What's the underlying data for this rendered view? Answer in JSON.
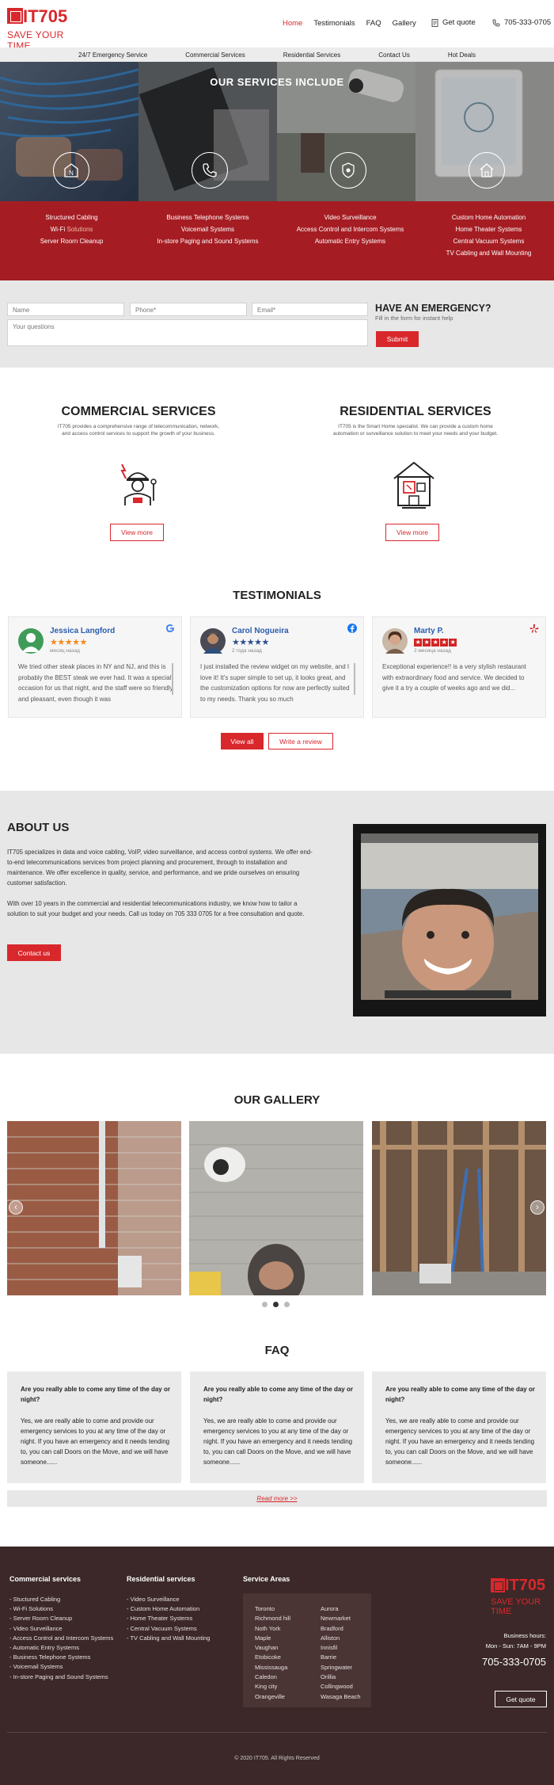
{
  "brand": {
    "name": "IT705",
    "tagline": "SAVE YOUR TIME"
  },
  "nav": {
    "items": [
      "Home",
      "Testimonials",
      "FAQ",
      "Gallery"
    ],
    "active": "Home",
    "quote": "Get quote",
    "phone": "705-333-0705"
  },
  "subnav": [
    "24/7 Emergency Service",
    "Commercial Services",
    "Residential Services",
    "Contact Us",
    "Hot Deals"
  ],
  "services": {
    "title": "OUR SERVICES INCLUDE",
    "columns": [
      {
        "icon": "network-icon",
        "items": [
          "Structured Cabling",
          "Wi-Fi Solutions",
          "Server Roorn Cleanup"
        ],
        "highlight": "Solutions"
      },
      {
        "icon": "phone-icon",
        "items": [
          "Business Telephone Systems",
          "Voicemail Systems",
          "In-store Paging and Sound Systems"
        ]
      },
      {
        "icon": "shield-icon",
        "items": [
          "Video Surveillance",
          "Access Control and Intercom Systems",
          "Automatic Entry Systems"
        ]
      },
      {
        "icon": "home-icon",
        "items": [
          "Custom Home Automation",
          "Home Theater Systems",
          "Central Vacuum Systems",
          "TV Cabling and Wall Mounting"
        ]
      }
    ]
  },
  "form": {
    "name_ph": "Name",
    "phone_ph": "Phone*",
    "email_ph": "Email*",
    "questions_ph": "Your questions",
    "title": "HAVE AN EMERGENCY?",
    "subtitle": "Fill in the form for instant help",
    "submit": "Submit"
  },
  "commercial": {
    "title": "COMMERCIAL SERVICES",
    "desc1": "IT705 provides a comprehensive range of telecommunication, network,",
    "desc2": "and access control services to support the growth of your business.",
    "button": "View more"
  },
  "residential": {
    "title": "RESIDENTIAL SERVICES",
    "desc1": "IT705 is the Smart Home specialist. We can provide a custom home",
    "desc2": "automation or surveillance solution to meet your needs and your budget.",
    "button": "View more"
  },
  "testimonials": {
    "title": "TESTIMONIALS",
    "reviews": [
      {
        "name": "Jessica Langford",
        "ago": "месяц назад",
        "source": "google-icon",
        "text": "We tried other steak places in NY and NJ, and this is probably the BEST steak we ever had. It was a special occasion for us that night, and the staff were so friendly and pleasant, even though it was"
      },
      {
        "name": "Carol Nogueira",
        "ago": "2 года назад",
        "source": "facebook-icon",
        "text": "I just installed the review widget on my website, and I love it! It's super simple to set up, it looks great, and the customization options for now are perfectly suited to my needs. Thank you so much"
      },
      {
        "name": "Marty P.",
        "ago": "2 месяца назад",
        "source": "yelp-icon",
        "text": "Exceptional experience!! is a very stylish restaurant with extraordinary food and service. We decided to give it a try a couple of weeks ago and we did..."
      }
    ],
    "view_all": "View all",
    "write": "Write a review"
  },
  "about": {
    "title": "ABOUT US",
    "p1": "IT705 specializes in data and voice cabling, VoIP, video surveillance, and access control systems. We offer end-to-end telecommunications services from project planning and procurement, through to installation and maintenance. We offer excellence in quality, service, and performance, and we pride ourselves on ensuring customer satisfaction.",
    "p2": "With over 10 years in the commercial and residential telecommunications industry, we know how to tailor a solution to suit your budget and your needs. Call us today on 705 333 0705 for a free consultation and quote.",
    "button": "Contact us"
  },
  "gallery": {
    "title": "OUR GALLERY",
    "active_dot": 1
  },
  "faq": {
    "title": "FAQ",
    "items": [
      {
        "q": "Are you really able to come any time of the day or night?",
        "a": "Yes, we are really able to come and provide our emergency services to you at any time of the day or night. If you have an emergency and it needs tending to, you can call Doors on the Move, and we will have someone......"
      },
      {
        "q": "Are you really able to come any time of the day or night?",
        "a": "Yes, we are really able to come and provide our emergency services to you at any time of the day or night. If you have an emergency and it needs tending to, you can call Doors on the Move, and we will have someone......"
      },
      {
        "q": "Are you really able to come any time of the day or night?",
        "a": "Yes, we are really able to come and provide our emergency services to you at any time of the day or night. If you have an emergency and it needs tending to, you can call Doors on the Move, and we will have someone......"
      }
    ],
    "read_more": "Read more >>"
  },
  "footer": {
    "commercial_title": "Commercial services",
    "commercial": [
      "- Stuctured Cabling",
      "- Wi-Fi Solutions",
      "- Server Roorn Cleanup",
      "- Video Surveillance",
      "- Access Control and Intercom Systems",
      "- Automatic Entry Systems",
      "- Business Telephone Systems",
      "- Voicemail Systems",
      "- In-store Paging and Sound Systems"
    ],
    "residential_title": "Residential services",
    "residential": [
      "- Video Surveillance",
      "- Custom Home Automation",
      "- Home Theater Systems",
      "- Central Vacuum Systems",
      "- TV Cabling and Wall Mounting"
    ],
    "areas_title": "Service Areas",
    "areas_col1": [
      "Toronto",
      "Richmond hill",
      "Noth York",
      "Maple",
      "Vaughan",
      "Etobicoke",
      "Mississauga",
      "Caledon",
      "King city",
      "Orangeville"
    ],
    "areas_col2": [
      "Aurora",
      "Newmarket",
      "Bradford",
      "Alliston",
      "Innisfil",
      "Barrie",
      "Springwater",
      "Orillia",
      "Collingwood",
      "Wasaga Beach"
    ],
    "hours_label": "Business hours:",
    "hours": "Mon - Sun: 7AM - 9PM",
    "phone": "705-333-0705",
    "quote": "Get quote",
    "copyright": "© 2020 IT705. All Rights Reserved"
  }
}
